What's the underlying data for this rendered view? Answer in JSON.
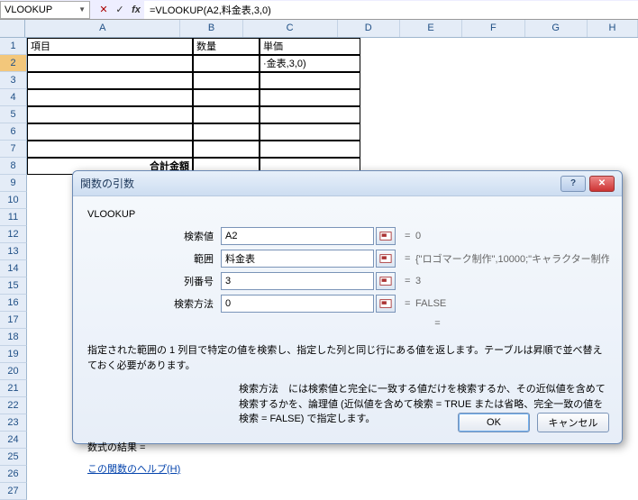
{
  "formula_bar": {
    "name_box": "VLOOKUP",
    "formula": "=VLOOKUP(A2,料金表,3,0)"
  },
  "columns": [
    "A",
    "B",
    "C",
    "D",
    "E",
    "F",
    "G",
    "H"
  ],
  "rows": [
    "1",
    "2",
    "3",
    "4",
    "5",
    "6",
    "7",
    "8",
    "9",
    "10",
    "11",
    "12",
    "13",
    "14",
    "15",
    "16",
    "17",
    "18",
    "19",
    "20",
    "21",
    "22",
    "23",
    "24",
    "25",
    "26",
    "27"
  ],
  "cells": {
    "A1": "項目",
    "B1": "数量",
    "C1": "単価",
    "C2": "·金表,3,0)",
    "A8_label": "合計金額"
  },
  "dialog": {
    "title": "関数の引数",
    "fn_name": "VLOOKUP",
    "args": [
      {
        "label": "検索値",
        "value": "A2",
        "result": "0"
      },
      {
        "label": "範囲",
        "value": "料金表",
        "result": "{\"ロゴマーク制作\",10000;\"キャラクター制作"
      },
      {
        "label": "列番号",
        "value": "3",
        "result": "3"
      },
      {
        "label": "検索方法",
        "value": "0",
        "result": "FALSE"
      }
    ],
    "desc1": "指定された範囲の 1 列目で特定の値を検索し、指定した列と同じ行にある値を返します。テーブルは昇順で並べ替えておく必要があります。",
    "desc2": "検索方法　には検索値と完全に一致する値だけを検索するか、その近似値を含めて検索するかを、論理値 (近似値を含めて検索 = TRUE または省略、完全一致の値を検索 = FALSE) で指定します。",
    "result_label": "数式の結果 =",
    "help_link": "この関数のヘルプ(H)",
    "ok": "OK",
    "cancel": "キャンセル"
  }
}
